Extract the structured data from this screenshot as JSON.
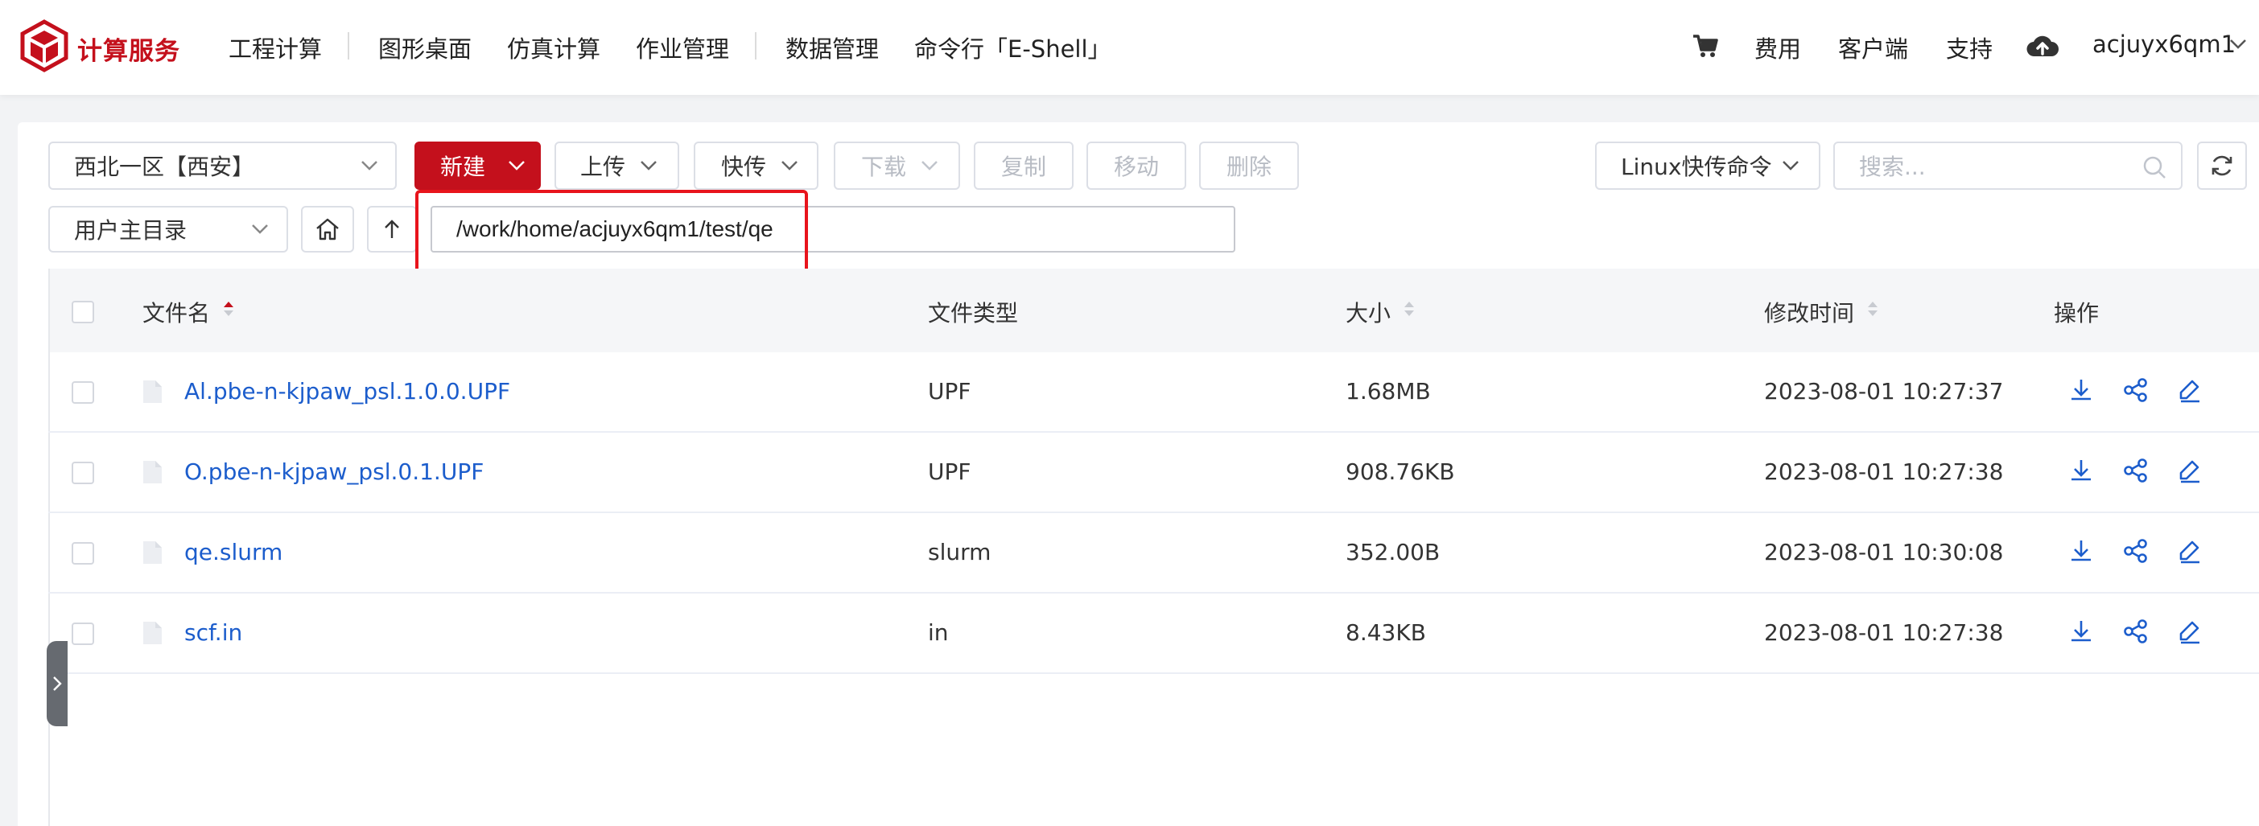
{
  "header": {
    "brand": "计算服务",
    "nav": [
      "工程计算",
      "图形桌面",
      "仿真计算",
      "作业管理",
      "数据管理",
      "命令行「E-Shell」"
    ],
    "right": {
      "fee": "费用",
      "client": "客户端",
      "support": "支持",
      "username": "acjuyx6qm1"
    }
  },
  "toolbar": {
    "region": "西北一区【西安】",
    "new": "新建",
    "upload": "上传",
    "fast": "快传",
    "download": "下载",
    "copy": "复制",
    "move": "移动",
    "delete": "删除",
    "linux_cmd": "Linux快传命令",
    "search_placeholder": "搜索..."
  },
  "pathbar": {
    "home_dir": "用户主目录",
    "path": "/work/home/acjuyx6qm1/test/qe"
  },
  "table": {
    "columns": [
      "文件名",
      "文件类型",
      "大小",
      "修改时间",
      "操作"
    ],
    "rows": [
      {
        "name": "Al.pbe-n-kjpaw_psl.1.0.0.UPF",
        "type": "UPF",
        "size": "1.68MB",
        "modified": "2023-08-01 10:27:37"
      },
      {
        "name": "O.pbe-n-kjpaw_psl.0.1.UPF",
        "type": "UPF",
        "size": "908.76KB",
        "modified": "2023-08-01 10:27:38"
      },
      {
        "name": "qe.slurm",
        "type": "slurm",
        "size": "352.00B",
        "modified": "2023-08-01 10:30:08"
      },
      {
        "name": "scf.in",
        "type": "in",
        "size": "8.43KB",
        "modified": "2023-08-01 10:27:38"
      }
    ]
  },
  "colors": {
    "brand_red": "#c4101c",
    "link_blue": "#1c5dcc",
    "highlight_red": "#e8141c"
  },
  "icons": [
    "logo-cube-icon",
    "cart-icon",
    "cloud-upload-icon",
    "chevron-down-icon",
    "home-icon",
    "arrow-up-icon",
    "search-icon",
    "refresh-icon",
    "file-icon",
    "download-icon",
    "share-icon",
    "edit-icon",
    "sort-icon",
    "chevron-right-icon"
  ]
}
